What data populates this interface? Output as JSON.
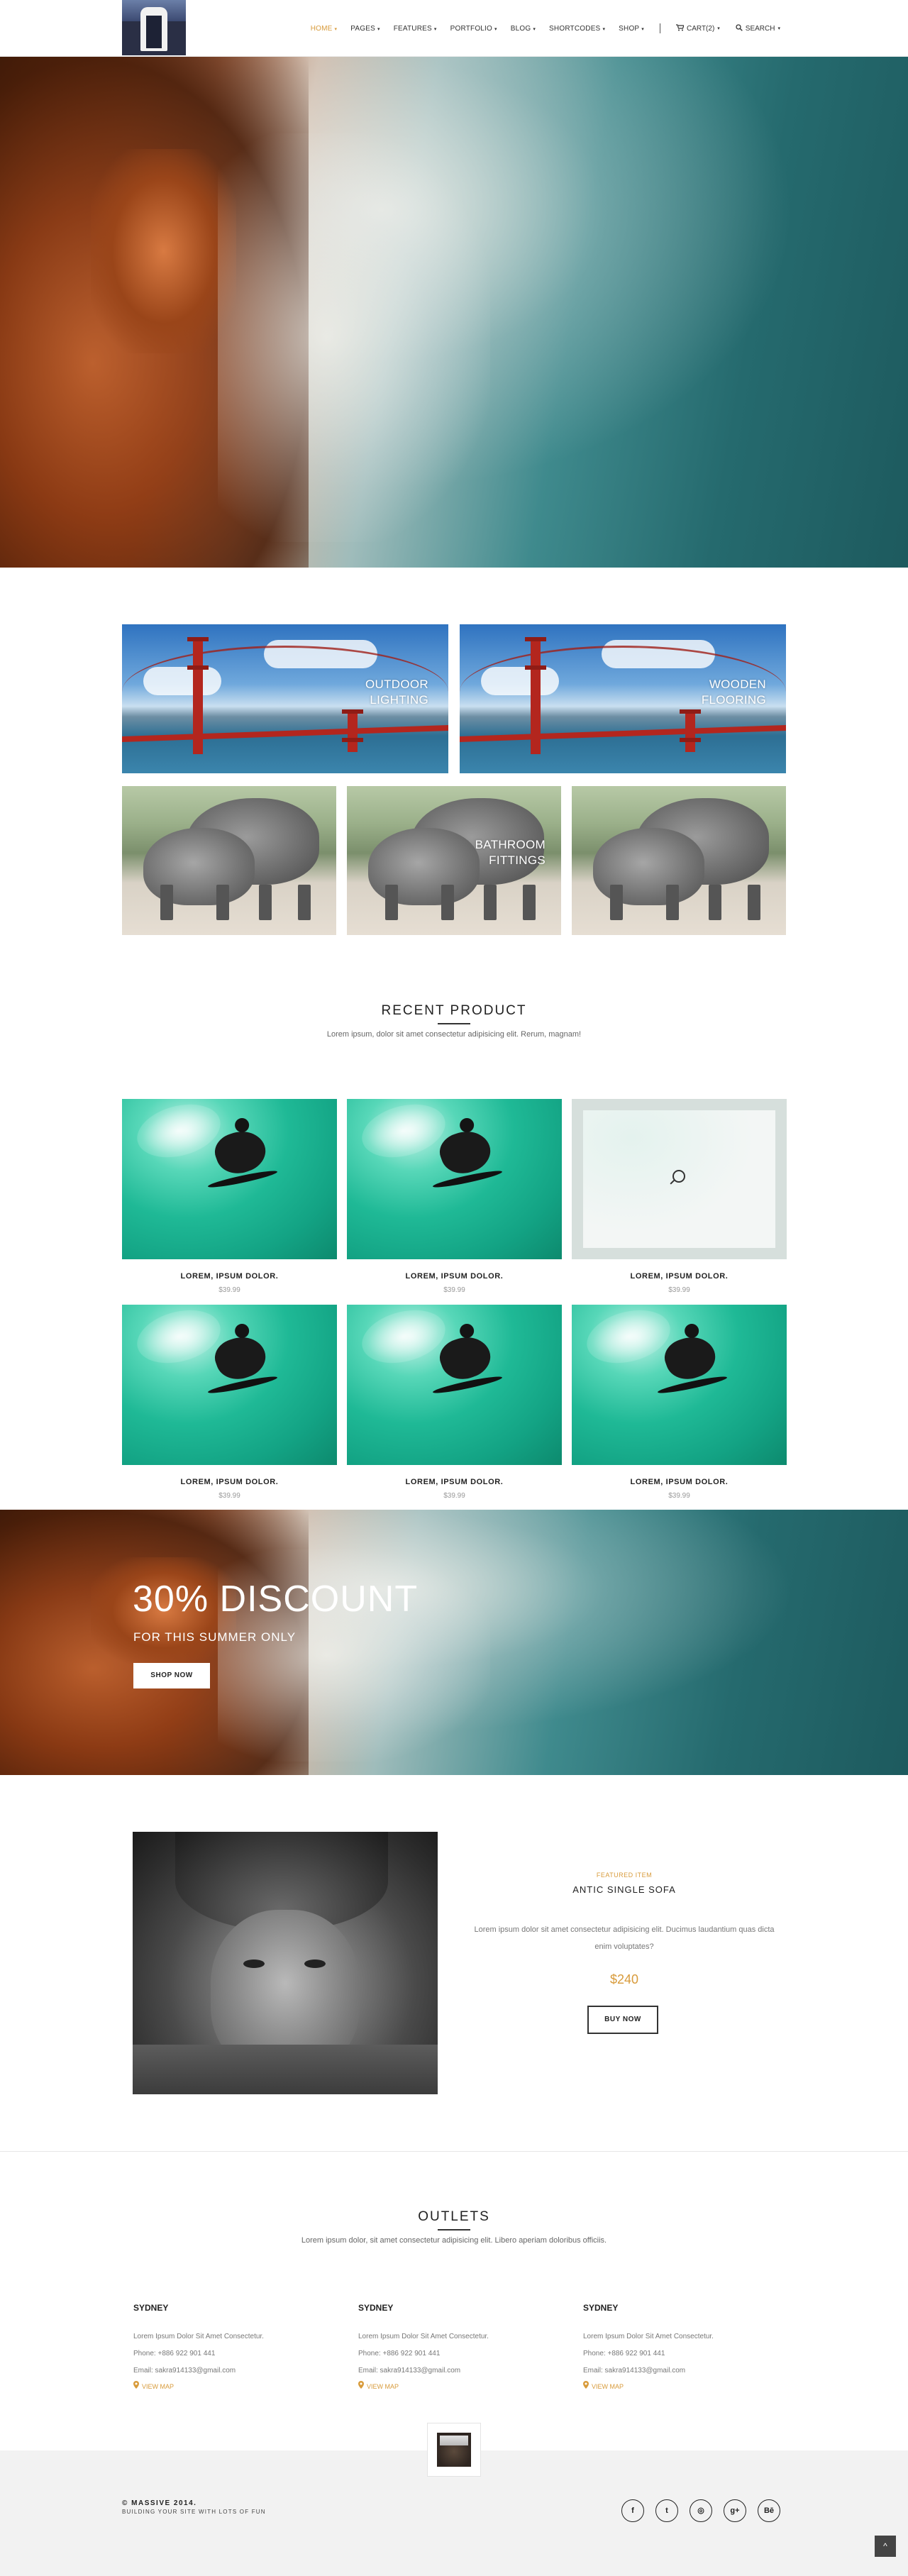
{
  "header": {
    "logo_alt": "",
    "nav": [
      {
        "label": "HOME",
        "active": true
      },
      {
        "label": "PAGES"
      },
      {
        "label": "FEATURES"
      },
      {
        "label": "PORTFOLIO"
      },
      {
        "label": "BLOG"
      },
      {
        "label": "SHORTCODES"
      },
      {
        "label": "SHOP"
      }
    ],
    "cart_label": "CART(2)",
    "search_label": "SEARCH",
    "accent_color": "#d89b3b"
  },
  "categories": [
    {
      "label_line1": "OUTDOOR",
      "label_line2": "LIGHTING"
    },
    {
      "label_line1": "WOODEN",
      "label_line2": "FLOORING"
    },
    {
      "label_line1": "",
      "label_line2": ""
    },
    {
      "label_line1": "BATHROOM",
      "label_line2": "FITTINGS"
    },
    {
      "label_line1": "",
      "label_line2": ""
    }
  ],
  "recent": {
    "title": "RECENT PRODUCT",
    "subtitle": "Lorem ipsum, dolor sit amet consectetur adipisicing elit. Rerum, magnam!",
    "products": [
      {
        "name": "LOREM, IPSUM DOLOR.",
        "price": "$39.99"
      },
      {
        "name": "LOREM, IPSUM DOLOR.",
        "price": "$39.99"
      },
      {
        "name": "LOREM, IPSUM DOLOR.",
        "price": "$39.99"
      },
      {
        "name": "LOREM, IPSUM DOLOR.",
        "price": "$39.99"
      },
      {
        "name": "LOREM, IPSUM DOLOR.",
        "price": "$39.99"
      },
      {
        "name": "LOREM, IPSUM DOLOR.",
        "price": "$39.99"
      }
    ]
  },
  "discount": {
    "title": "30% DISCOUNT",
    "subtitle": "FOR THIS SUMMER ONLY",
    "button": "SHOP NOW"
  },
  "featured": {
    "label": "FEATURED ITEM",
    "name": "ANTIC SINGLE SOFA",
    "description": "Lorem ipsum dolor sit amet consectetur adipisicing elit. Ducimus laudantium quas dicta enim voluptates?",
    "price": "$240",
    "button": "BUY NOW"
  },
  "outlets": {
    "title": "OUTLETS",
    "subtitle": "Lorem ipsum dolor, sit amet consectetur adipisicing elit. Libero aperiam doloribus officiis.",
    "items": [
      {
        "city": "SYDNEY",
        "address": "Lorem Ipsum Dolor Sit Amet Consectetur.",
        "phone": "Phone: +886 922 901 441",
        "email": "Email: sakra914133@gmail.com",
        "map": "VIEW MAP"
      },
      {
        "city": "SYDNEY",
        "address": "Lorem Ipsum Dolor Sit Amet Consectetur.",
        "phone": "Phone: +886 922 901 441",
        "email": "Email: sakra914133@gmail.com",
        "map": "VIEW MAP"
      },
      {
        "city": "SYDNEY",
        "address": "Lorem Ipsum Dolor Sit Amet Consectetur.",
        "phone": "Phone: +886 922 901 441",
        "email": "Email: sakra914133@gmail.com",
        "map": "VIEW MAP"
      }
    ]
  },
  "footer": {
    "copyright": "© MASSIVE 2014.",
    "tagline": "BUILDING YOUR SITE WITH LOTS OF FUN",
    "social": [
      {
        "icon": "facebook-icon",
        "glyph": "f"
      },
      {
        "icon": "twitter-icon",
        "glyph": "t"
      },
      {
        "icon": "dribbble-icon",
        "glyph": "◎"
      },
      {
        "icon": "google-plus-icon",
        "glyph": "g+"
      },
      {
        "icon": "behance-icon",
        "glyph": "Bē"
      }
    ],
    "back_to_top_icon": "chevron-up-icon"
  }
}
